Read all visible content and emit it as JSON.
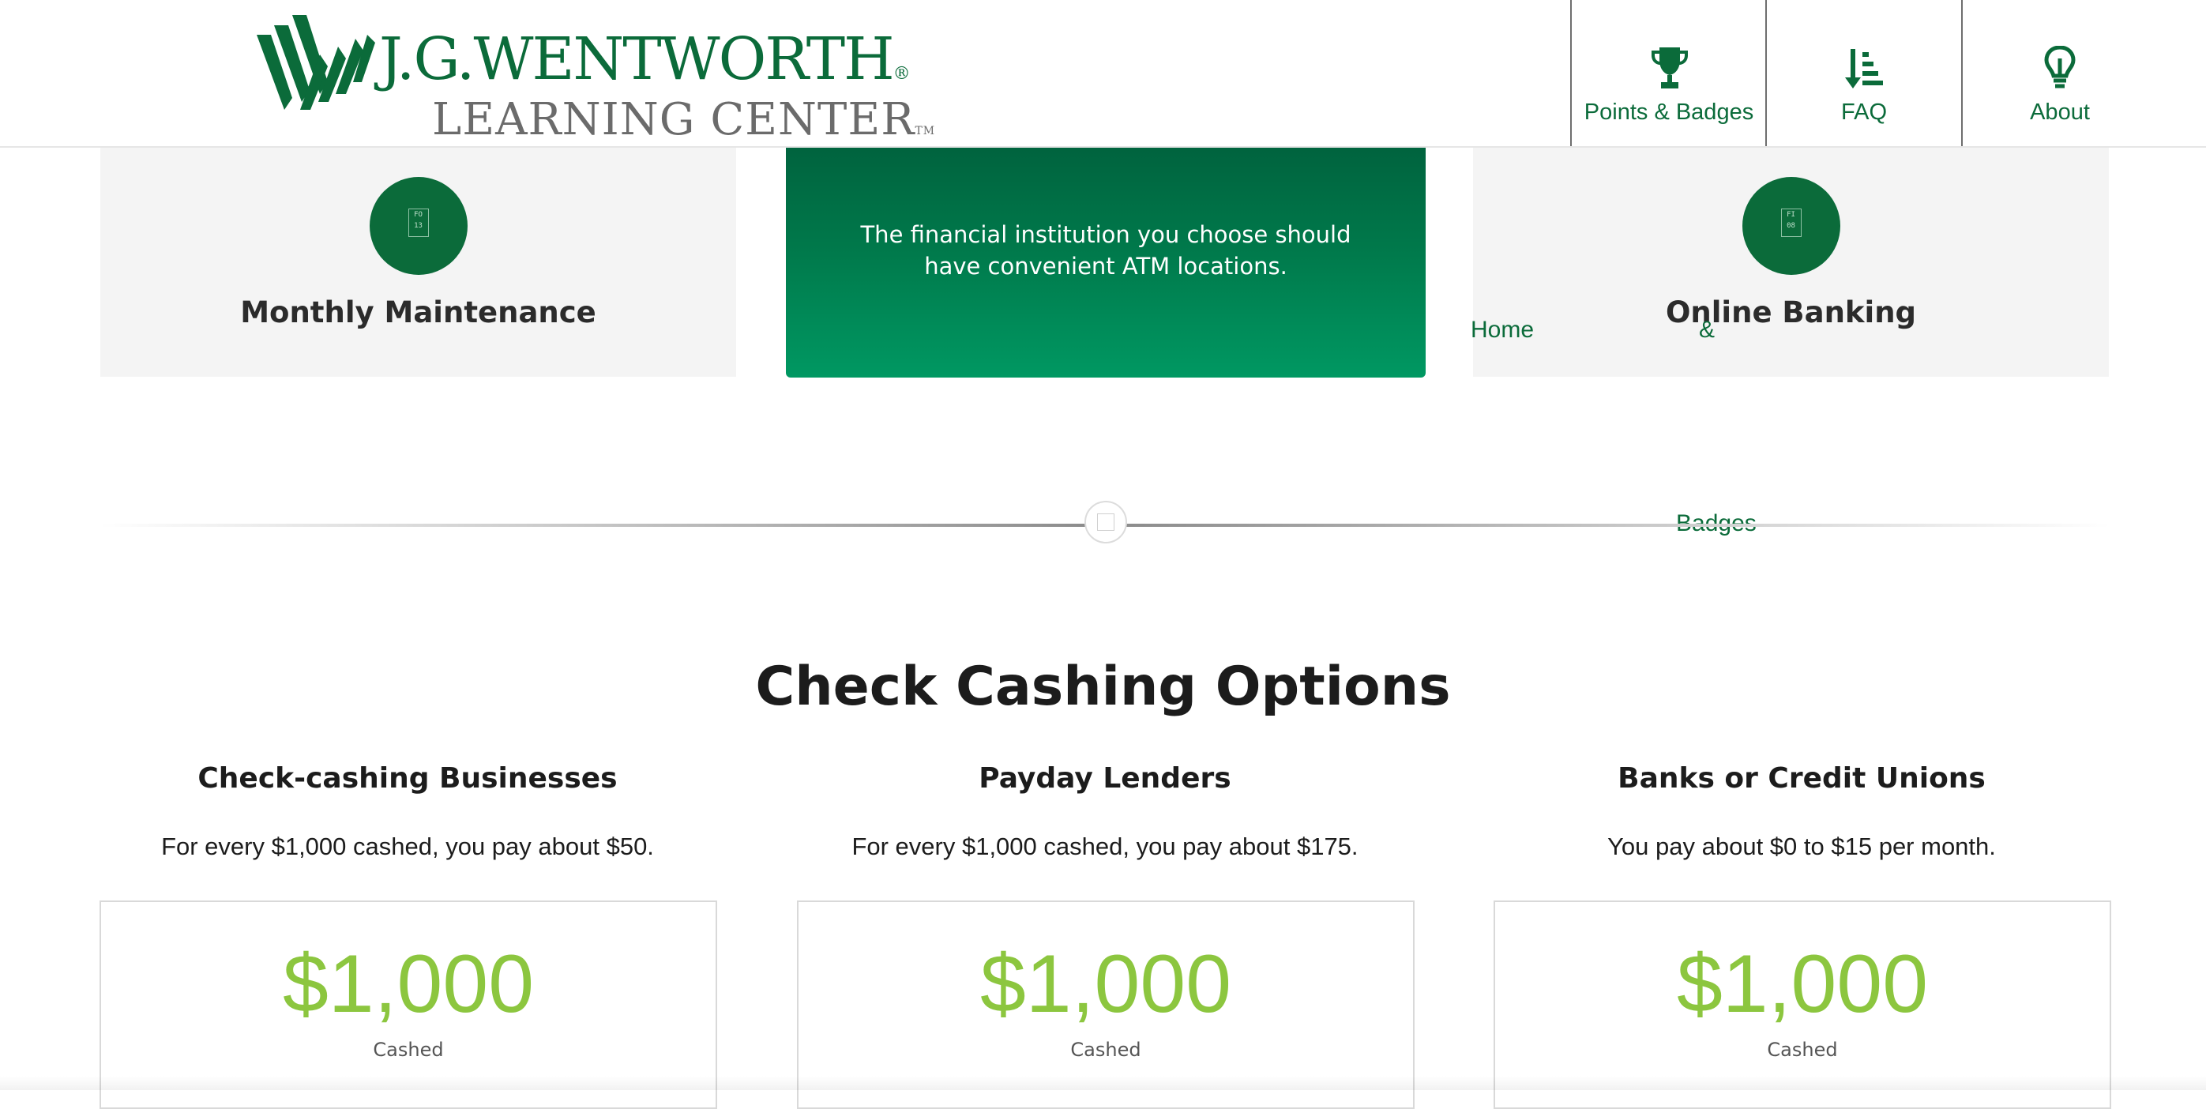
{
  "colors": {
    "brand_green": "#0b6b3a",
    "accent_green": "#8cc63f",
    "card_gray": "#f4f4f4"
  },
  "header": {
    "logo": {
      "line1": "J.G.WENTWORTH",
      "registered_mark": "®",
      "line2": "LEARNING CENTER",
      "trademark": "TM"
    },
    "nav": [
      {
        "label": "Points & Badges",
        "icon": "trophy-icon"
      },
      {
        "label": "FAQ",
        "icon": "sort-list-icon"
      },
      {
        "label": "About",
        "icon": "lightbulb-icon"
      }
    ]
  },
  "slider": {
    "cards": [
      {
        "title": "Monthly Maintenance",
        "icon": "calendar-tile-icon",
        "icon_text": "FO 13"
      },
      {
        "text": "The financial institution you choose should have convenient ATM locations."
      },
      {
        "title": "Online Banking",
        "icon": "calendar-tile-icon",
        "icon_text": "FI 08"
      }
    ],
    "stray_links": {
      "home": "Home",
      "amp": "&",
      "badges": "Badges"
    }
  },
  "section": {
    "title": "Check Cashing Options",
    "options": [
      {
        "heading": "Check-cashing Businesses",
        "description": "For every $1,000 cashed, you pay about $50.",
        "amount": "$1,000",
        "amount_label": "Cashed"
      },
      {
        "heading": "Payday Lenders",
        "description": "For every $1,000 cashed, you pay about $175.",
        "amount": "$1,000",
        "amount_label": "Cashed"
      },
      {
        "heading": "Banks or Credit Unions",
        "description": "You pay about $0 to $15 per month.",
        "amount": "$1,000",
        "amount_label": "Cashed"
      }
    ]
  }
}
